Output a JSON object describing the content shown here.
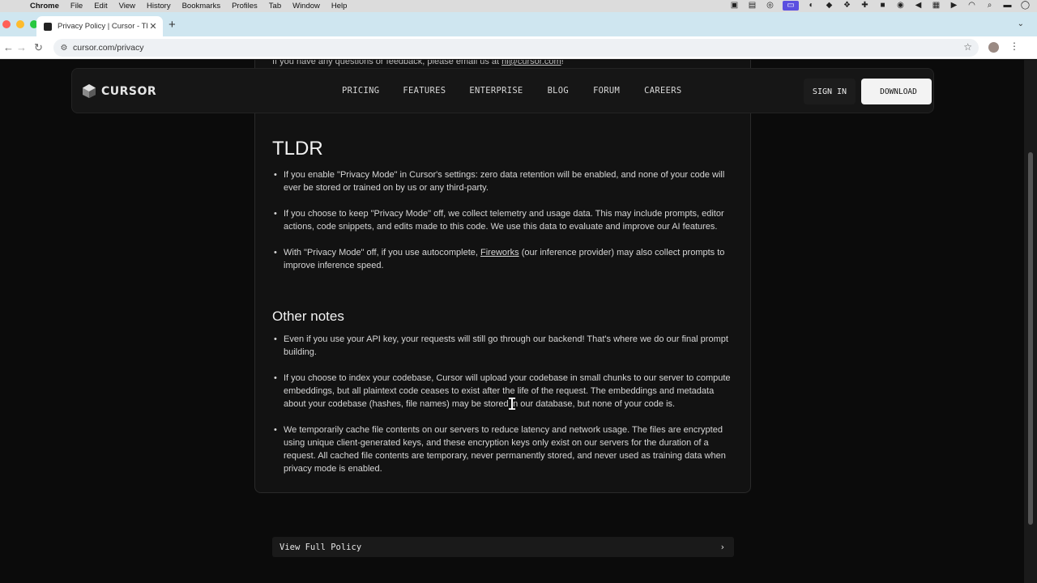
{
  "menubar": {
    "app_name": "Chrome",
    "items": [
      "File",
      "Edit",
      "View",
      "History",
      "Bookmarks",
      "Profiles",
      "Tab",
      "Window",
      "Help"
    ]
  },
  "browser": {
    "tab_title": "Privacy Policy | Cursor - The",
    "url": "cursor.com/privacy"
  },
  "page": {
    "top_line_text": "If you have any questions or feedback, please email us at",
    "top_line_email": "hi@cursor.com",
    "top_line_suffix": "!",
    "nav": {
      "logo_text": "CURSOR",
      "links": [
        "PRICING",
        "FEATURES",
        "ENTERPRISE",
        "BLOG",
        "FORUM",
        "CAREERS"
      ],
      "sign_in": "SIGN IN",
      "download": "DOWNLOAD"
    },
    "tldr": {
      "heading": "TLDR",
      "bullets": [
        "If you enable \"Privacy Mode\" in Cursor's settings: zero data retention will be enabled, and none of your code will ever be stored or trained on by us or any third-party.",
        "If you choose to keep \"Privacy Mode\" off, we collect telemetry and usage data. This may include prompts, editor actions, code snippets, and edits made to this code. We use this data to evaluate and improve our AI features."
      ],
      "bullet3_prefix": "With \"Privacy Mode\" off, if you use autocomplete, ",
      "bullet3_link": "Fireworks",
      "bullet3_suffix": " (our inference provider) may also collect prompts to improve inference speed."
    },
    "other_notes": {
      "heading": "Other notes",
      "bullets": [
        "Even if you use your API key, your requests will still go through our backend! That's where we do our final prompt building.",
        "If you choose to index your codebase, Cursor will upload your codebase in small chunks to our server to compute embeddings, but all plaintext code ceases to exist after the life of the request. The embeddings and metadata about your codebase (hashes, file names) may be stored in our database, but none of your code is.",
        "We temporarily cache file contents on our servers to reduce latency and network usage. The files are encrypted using unique client-generated keys, and these encryption keys only exist on our servers for the duration of a request. All cached file contents are temporary, never permanently stored, and never used as training data when privacy mode is enabled."
      ]
    },
    "full_policy_button": "View Full Policy"
  },
  "colors": {
    "page_bg": "#0b0b0b",
    "card_bg": "#121212",
    "tabstrip_bg": "#cfe6f0",
    "download_bg": "#f3f3f3"
  },
  "icons": [
    "apple-icon",
    "favicon-icon",
    "close-icon",
    "plus-icon",
    "back-icon",
    "forward-icon",
    "reload-icon",
    "site-info-icon",
    "star-icon",
    "profile-avatar",
    "kebab-menu-icon",
    "cursor-logo-icon",
    "chevron-right-icon",
    "text-cursor-icon"
  ]
}
